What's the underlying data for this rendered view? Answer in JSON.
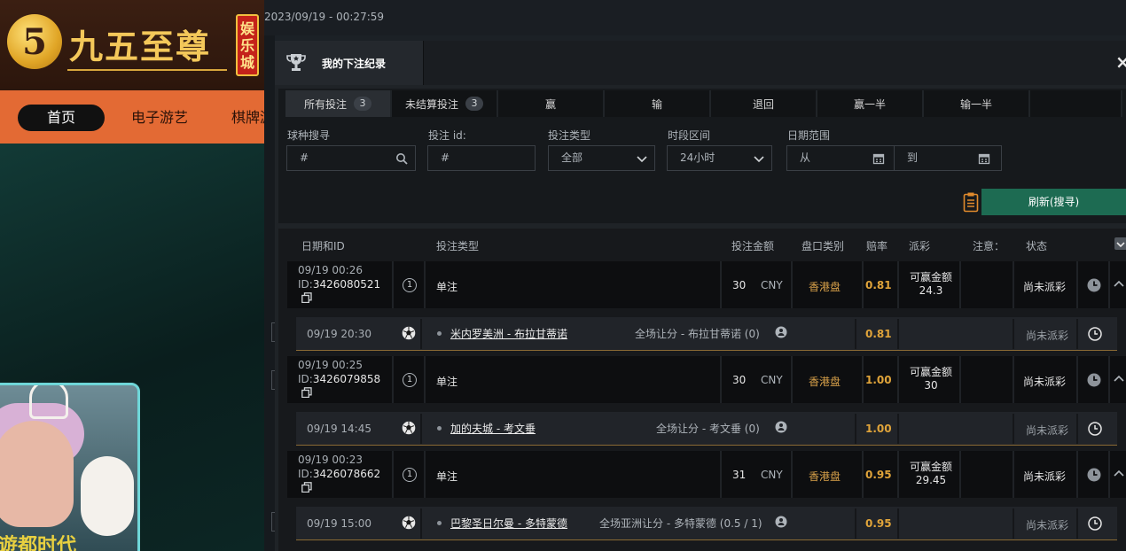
{
  "site": {
    "logo_glyph": "5",
    "logo_text": "九五至尊",
    "logo_badge": [
      "娱",
      "乐",
      "城"
    ],
    "nav": [
      "首页",
      "电子游艺",
      "棋牌游"
    ],
    "banner_text": "遊都时代"
  },
  "datetime": "2023/09/19 - 00:27:59",
  "modal": {
    "title": "我的下注纪录",
    "close_glyph": "×",
    "tabs": [
      {
        "label": "所有投注",
        "count": "3"
      },
      {
        "label": "未结算投注",
        "count": "3"
      },
      {
        "label": "赢"
      },
      {
        "label": "输"
      },
      {
        "label": "退回"
      },
      {
        "label": "赢一半"
      },
      {
        "label": "输一半"
      }
    ],
    "filters": {
      "ball_search_label": "球种搜寻",
      "ball_search_placeholder": "#",
      "bet_id_label": "投注 id:",
      "bet_id_placeholder": "#",
      "bet_type_label": "投注类型",
      "bet_type_value": "全部",
      "period_label": "时段区间",
      "period_value": "24小时",
      "date_range_label": "日期范围",
      "date_from_placeholder": "从",
      "date_to_placeholder": "到"
    },
    "refresh_label": "刷新(搜寻)",
    "columns": [
      "日期和ID",
      "投注类型",
      "投注金额",
      "盘口类别",
      "赔率",
      "派彩",
      "注意：",
      "状态"
    ],
    "bets": [
      {
        "date": "09/19 00:26",
        "id_prefix": "ID:",
        "id": "3426080521",
        "num": "1",
        "type": "单注",
        "amount": "30",
        "currency": "CNY",
        "market": "香港盘",
        "odds": "0.81",
        "win_label": "可赢金额",
        "win_value": "24.3",
        "status": "尚未派彩",
        "leg": {
          "date": "09/19 20:30",
          "match": "米内罗美洲 - 布拉甘蒂诺",
          "selection": "全场让分 - 布拉甘蒂诺 (0)",
          "odds": "0.81",
          "status": "尚未派彩"
        }
      },
      {
        "date": "09/19 00:25",
        "id_prefix": "ID:",
        "id": "3426079858",
        "num": "1",
        "type": "单注",
        "amount": "30",
        "currency": "CNY",
        "market": "香港盘",
        "odds": "1.00",
        "win_label": "可赢金额",
        "win_value": "30",
        "status": "尚未派彩",
        "leg": {
          "date": "09/19 14:45",
          "match": "加的夫城 - 考文垂",
          "selection": "全场让分 - 考文垂 (0)",
          "odds": "1.00",
          "status": "尚未派彩"
        }
      },
      {
        "date": "09/19 00:23",
        "id_prefix": "ID:",
        "id": "3426078662",
        "num": "1",
        "type": "单注",
        "amount": "31",
        "currency": "CNY",
        "market": "香港盘",
        "odds": "0.95",
        "win_label": "可赢金额",
        "win_value": "29.45",
        "status": "尚未派彩",
        "leg": {
          "date": "09/19 15:00",
          "match": "巴黎圣日尔曼 - 多特蒙德",
          "selection": "全场亚洲让分 - 多特蒙德 (0.5 / 1)",
          "odds": "0.95",
          "status": "尚未派彩"
        }
      }
    ]
  },
  "colors": {
    "accent_green": "#1d6b52",
    "odds_gold": "#e0a43a",
    "nav_orange": "#e36a34"
  }
}
